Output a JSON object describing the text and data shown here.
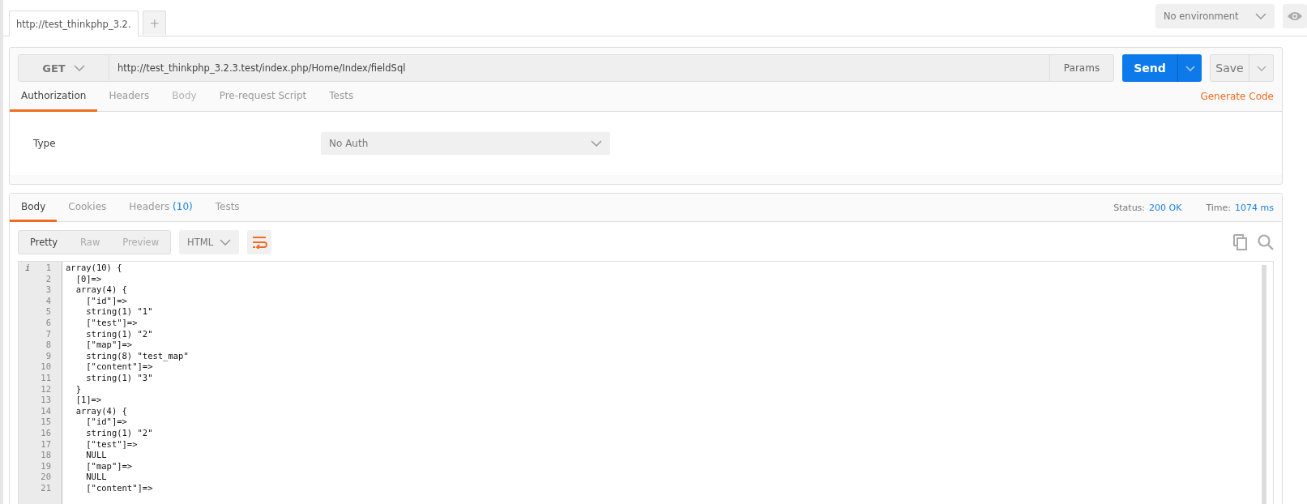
{
  "tabs": [
    {
      "label": "http://test_thinkphp_3.2.",
      "selected": true
    },
    {
      "label": "+",
      "kind": "add",
      "selected": false
    }
  ],
  "environment": {
    "value": "No environment"
  },
  "request": {
    "method": "GET",
    "url": "http://test_thinkphp_3.2.3.test/index.php/Home/Index/fieldSql",
    "params_label": "Params",
    "send_label": "Send",
    "save_label": "Save"
  },
  "request_tabs": [
    {
      "label": "Authorization",
      "selected": true,
      "disabled": false
    },
    {
      "label": "Headers",
      "selected": false,
      "disabled": false
    },
    {
      "label": "Body",
      "selected": false,
      "disabled": true
    },
    {
      "label": "Pre-request Script",
      "selected": false,
      "disabled": false
    },
    {
      "label": "Tests",
      "selected": false,
      "disabled": false
    }
  ],
  "generate_code": "Generate Code",
  "auth": {
    "label": "Type",
    "value": "No Auth"
  },
  "response_tabs": [
    {
      "label": "Body",
      "selected": true
    },
    {
      "label": "Cookies",
      "selected": false
    },
    {
      "label": "Headers",
      "count": "(10)",
      "selected": false
    },
    {
      "label": "Tests",
      "selected": false
    }
  ],
  "status": {
    "label": "Status:",
    "value": "200 OK"
  },
  "time": {
    "label": "Time:",
    "value": "1074 ms"
  },
  "view_modes": [
    {
      "label": "Pretty",
      "selected": true
    },
    {
      "label": "Raw",
      "selected": false
    },
    {
      "label": "Preview",
      "selected": false
    }
  ],
  "format": "HTML",
  "gutter_mark": "i",
  "code_lines": [
    {
      "number": "1",
      "text": "array(10) {"
    },
    {
      "number": "2",
      "text": "  [0]=>"
    },
    {
      "number": "3",
      "text": "  array(4) {"
    },
    {
      "number": "4",
      "text": "    [\"id\"]=>"
    },
    {
      "number": "5",
      "text": "    string(1) \"1\""
    },
    {
      "number": "6",
      "text": "    [\"test\"]=>"
    },
    {
      "number": "7",
      "text": "    string(1) \"2\""
    },
    {
      "number": "8",
      "text": "    [\"map\"]=>"
    },
    {
      "number": "9",
      "text": "    string(8) \"test_map\""
    },
    {
      "number": "10",
      "text": "    [\"content\"]=>"
    },
    {
      "number": "11",
      "text": "    string(1) \"3\""
    },
    {
      "number": "12",
      "text": "  }"
    },
    {
      "number": "13",
      "text": "  [1]=>"
    },
    {
      "number": "14",
      "text": "  array(4) {"
    },
    {
      "number": "15",
      "text": "    [\"id\"]=>"
    },
    {
      "number": "16",
      "text": "    string(1) \"2\""
    },
    {
      "number": "17",
      "text": "    [\"test\"]=>"
    },
    {
      "number": "18",
      "text": "    NULL"
    },
    {
      "number": "19",
      "text": "    [\"map\"]=>"
    },
    {
      "number": "20",
      "text": "    NULL"
    },
    {
      "number": "21",
      "text": "    [\"content\"]=>"
    }
  ]
}
